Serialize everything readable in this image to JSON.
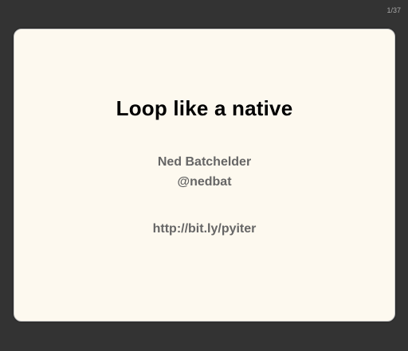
{
  "presentation": {
    "page_counter": "1/37"
  },
  "slide": {
    "title": "Loop like a native",
    "author": "Ned Batchelder",
    "handle": "@nedbat",
    "url": "http://bit.ly/pyiter"
  },
  "colors": {
    "background": "#333333",
    "slide_background": "#fdf9ef",
    "title_text": "#000000",
    "body_text": "#666666",
    "counter_text": "#a8a8a8"
  }
}
